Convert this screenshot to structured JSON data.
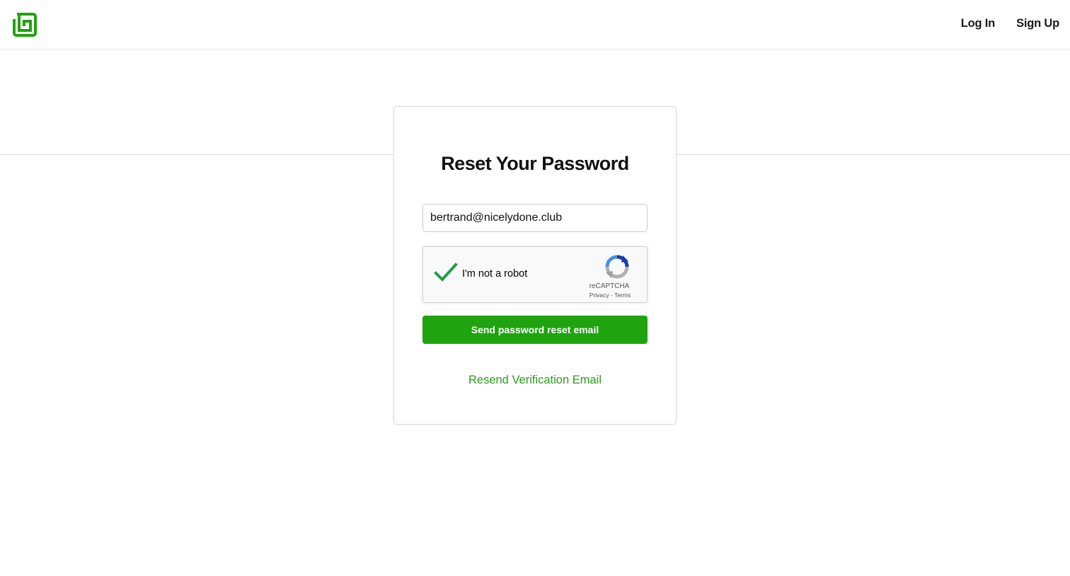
{
  "colors": {
    "brand_green": "#1fa40f",
    "link_green": "#2a9d1a",
    "recaptcha_check": "#1e9e4a"
  },
  "header": {
    "logo_icon": "brand-logo-icon",
    "nav": {
      "login_label": "Log In",
      "signup_label": "Sign Up"
    }
  },
  "form": {
    "title": "Reset Your Password",
    "email_value": "bertrand@nicelydone.club",
    "recaptcha": {
      "checked": true,
      "label": "I'm not a robot",
      "brand": "reCAPTCHA",
      "privacy_label": "Privacy",
      "separator": " - ",
      "terms_label": "Terms"
    },
    "submit_label": "Send password reset email",
    "resend_label": "Resend Verification Email"
  }
}
